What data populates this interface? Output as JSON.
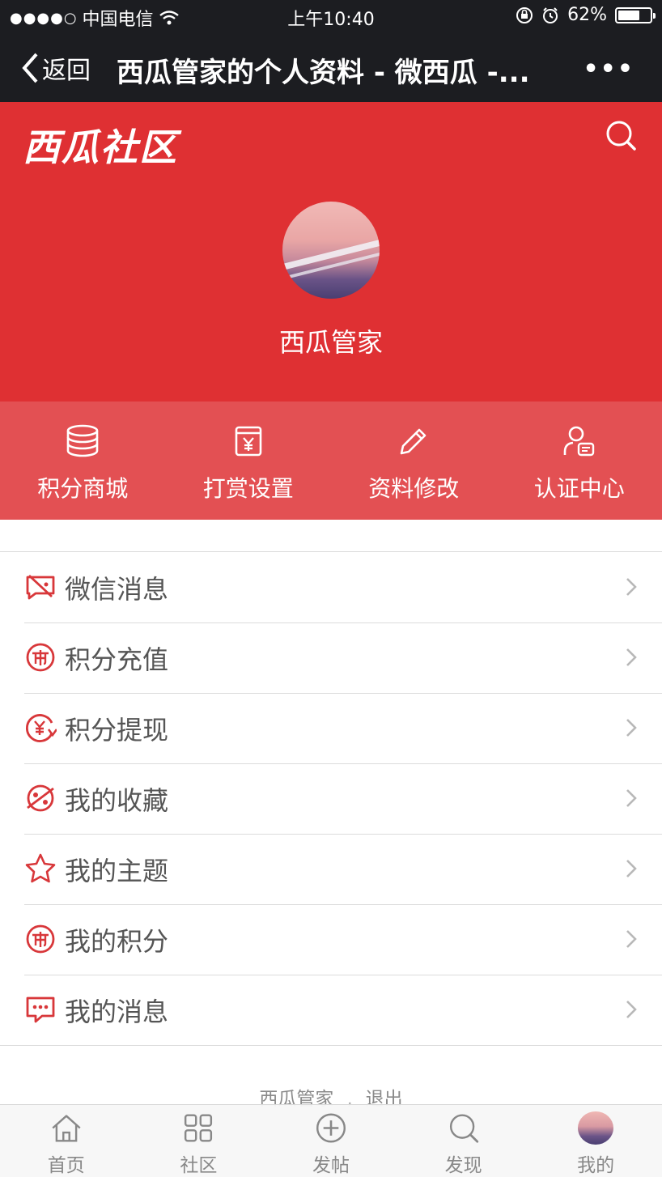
{
  "statusbar": {
    "signal": "●●●●○",
    "carrier": "中国电信",
    "time": "上午10:40",
    "battery_percent": "62%"
  },
  "navbar": {
    "back_label": "返回",
    "title": "西瓜管家的个人资料 - 微西瓜 -...",
    "more_label": "•••"
  },
  "header": {
    "logo": "西瓜社区",
    "username": "西瓜管家"
  },
  "quick_actions": [
    {
      "label": "积分商城",
      "icon": "database-icon"
    },
    {
      "label": "打赏设置",
      "icon": "yuan-box-icon"
    },
    {
      "label": "资料修改",
      "icon": "pencil-icon"
    },
    {
      "label": "认证中心",
      "icon": "person-id-icon"
    }
  ],
  "menu": [
    {
      "label": "微信消息",
      "icon": "wechat-msg-icon"
    },
    {
      "label": "积分充值",
      "icon": "coin-icon"
    },
    {
      "label": "积分提现",
      "icon": "withdraw-icon"
    },
    {
      "label": "我的收藏",
      "icon": "favorite-icon"
    },
    {
      "label": "我的主题",
      "icon": "star-icon"
    },
    {
      "label": "我的积分",
      "icon": "coin-icon"
    },
    {
      "label": "我的消息",
      "icon": "message-icon"
    }
  ],
  "footer": {
    "user": "西瓜管家",
    "separator": ",",
    "logout": "退出"
  },
  "tabbar": [
    {
      "label": "首页",
      "icon": "home-icon"
    },
    {
      "label": "社区",
      "icon": "grid-icon"
    },
    {
      "label": "发帖",
      "icon": "plus-circle-icon"
    },
    {
      "label": "发现",
      "icon": "search-icon"
    },
    {
      "label": "我的",
      "icon": "avatar-icon"
    }
  ],
  "colors": {
    "brand_red": "#df3033",
    "quickbar_red": "#e35053",
    "dark_bar": "#1c1d21",
    "icon_red": "#d8373a"
  }
}
